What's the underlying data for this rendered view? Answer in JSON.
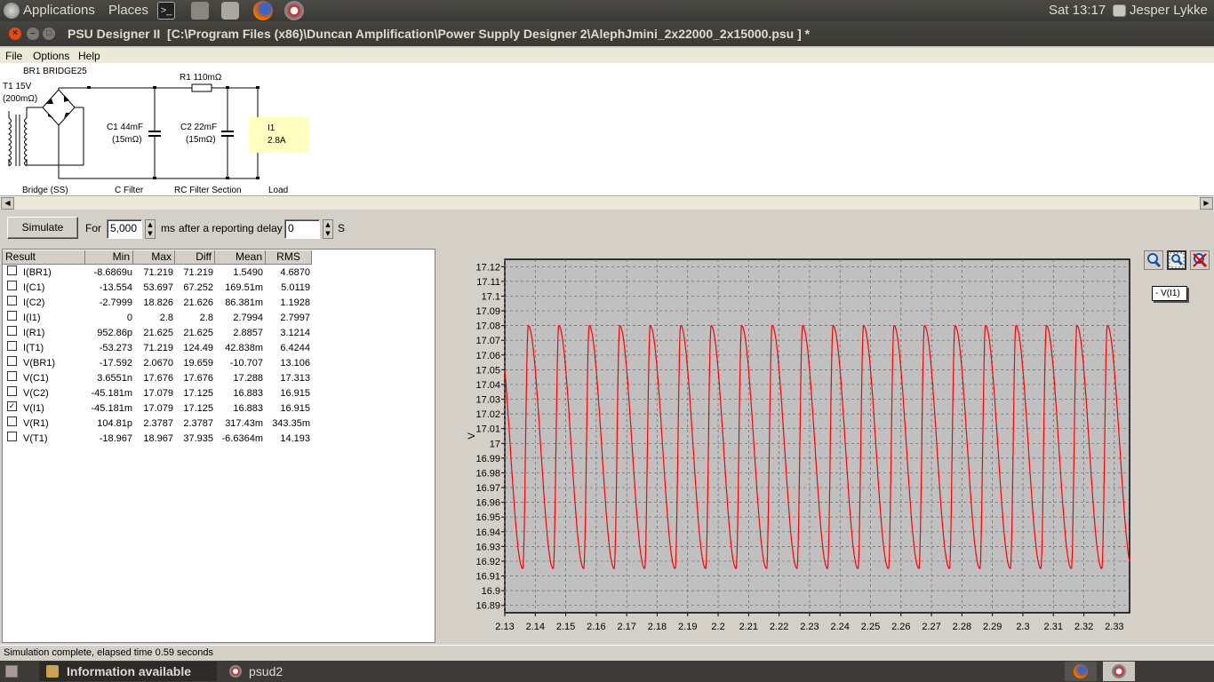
{
  "top_panel": {
    "applications": "Applications",
    "places": "Places",
    "clock": "Sat 13:17",
    "user": "Jesper Lykke"
  },
  "window": {
    "title": "PSU Designer II  [C:\\Program Files (x86)\\Duncan Amplification\\Power Supply Designer 2\\AlephJmini_2x22000_2x15000.psu ] *"
  },
  "menu": {
    "file": "File",
    "options": "Options",
    "help": "Help"
  },
  "schematic": {
    "t1_name": "T1 15V",
    "t1_res": "(200mΩ)",
    "br1": "BR1 BRIDGE25",
    "r1": "R1 110mΩ",
    "c1_name": "C1 44mF",
    "c1_esr": "(15mΩ)",
    "c2_name": "C2 22mF",
    "c2_esr": "(15mΩ)",
    "i1_name": "I1",
    "i1_val": "2.8A",
    "sections": [
      "Bridge (SS)",
      "C Filter",
      "RC Filter Section",
      "Load"
    ]
  },
  "sim": {
    "simulate": "Simulate",
    "for": "For",
    "duration": "5,000",
    "ms": "ms",
    "after": "after a reporting delay of",
    "delay": "0",
    "s": "S"
  },
  "results": {
    "headers": [
      "Result",
      "Min",
      "Max",
      "Diff",
      "Mean",
      "RMS"
    ],
    "rows": [
      {
        "name": "I(BR1)",
        "min": "-8.6869u",
        "max": "71.219",
        "diff": "71.219",
        "mean": "1.5490",
        "rms": "4.6870",
        "checked": false
      },
      {
        "name": "I(C1)",
        "min": "-13.554",
        "max": "53.697",
        "diff": "67.252",
        "mean": "169.51m",
        "rms": "5.0119",
        "checked": false
      },
      {
        "name": "I(C2)",
        "min": "-2.7999",
        "max": "18.826",
        "diff": "21.626",
        "mean": "86.381m",
        "rms": "1.1928",
        "checked": false
      },
      {
        "name": "I(I1)",
        "min": "0",
        "max": "2.8",
        "diff": "2.8",
        "mean": "2.7994",
        "rms": "2.7997",
        "checked": false
      },
      {
        "name": "I(R1)",
        "min": "952.86p",
        "max": "21.625",
        "diff": "21.625",
        "mean": "2.8857",
        "rms": "3.1214",
        "checked": false
      },
      {
        "name": "I(T1)",
        "min": "-53.273",
        "max": "71.219",
        "diff": "124.49",
        "mean": "42.838m",
        "rms": "6.4244",
        "checked": false
      },
      {
        "name": "V(BR1)",
        "min": "-17.592",
        "max": "2.0670",
        "diff": "19.659",
        "mean": "-10.707",
        "rms": "13.106",
        "checked": false
      },
      {
        "name": "V(C1)",
        "min": "3.6551n",
        "max": "17.676",
        "diff": "17.676",
        "mean": "17.288",
        "rms": "17.313",
        "checked": false
      },
      {
        "name": "V(C2)",
        "min": "-45.181m",
        "max": "17.079",
        "diff": "17.125",
        "mean": "16.883",
        "rms": "16.915",
        "checked": false
      },
      {
        "name": "V(I1)",
        "min": "-45.181m",
        "max": "17.079",
        "diff": "17.125",
        "mean": "16.883",
        "rms": "16.915",
        "checked": true
      },
      {
        "name": "V(R1)",
        "min": "104.81p",
        "max": "2.3787",
        "diff": "2.3787",
        "mean": "317.43m",
        "rms": "343.35m",
        "checked": false
      },
      {
        "name": "V(T1)",
        "min": "-18.967",
        "max": "18.967",
        "diff": "37.935",
        "mean": "-6.6364m",
        "rms": "14.193",
        "checked": false
      }
    ]
  },
  "chart_data": {
    "type": "line",
    "ylabel": "V",
    "xlim": [
      2.13,
      2.335
    ],
    "ylim": [
      16.885,
      17.125
    ],
    "yticks": [
      "17.12",
      "17.11",
      "17.1",
      "17.09",
      "17.08",
      "17.07",
      "17.06",
      "17.05",
      "17.04",
      "17.03",
      "17.02",
      "17.01",
      "17",
      "16.99",
      "16.98",
      "16.97",
      "16.96",
      "16.95",
      "16.94",
      "16.93",
      "16.92",
      "16.91",
      "16.9",
      "16.89"
    ],
    "xticks": [
      "2.13",
      "2.14",
      "2.15",
      "2.16",
      "2.17",
      "2.18",
      "2.19",
      "2.2",
      "2.21",
      "2.22",
      "2.23",
      "2.24",
      "2.25",
      "2.26",
      "2.27",
      "2.28",
      "2.29",
      "2.3",
      "2.31",
      "2.32",
      "2.33"
    ],
    "grid": true,
    "legend": "top-right",
    "series": [
      {
        "name": "V(I1)",
        "color": "#ff0000",
        "period": 0.01,
        "first_peak_x": 2.1377,
        "max": 17.08,
        "min": 16.915
      }
    ]
  },
  "chart_legend": "- V(I1)",
  "status": "Simulation complete, elapsed time 0.59 seconds",
  "taskbar": {
    "info": "Information available",
    "app": "psud2"
  }
}
